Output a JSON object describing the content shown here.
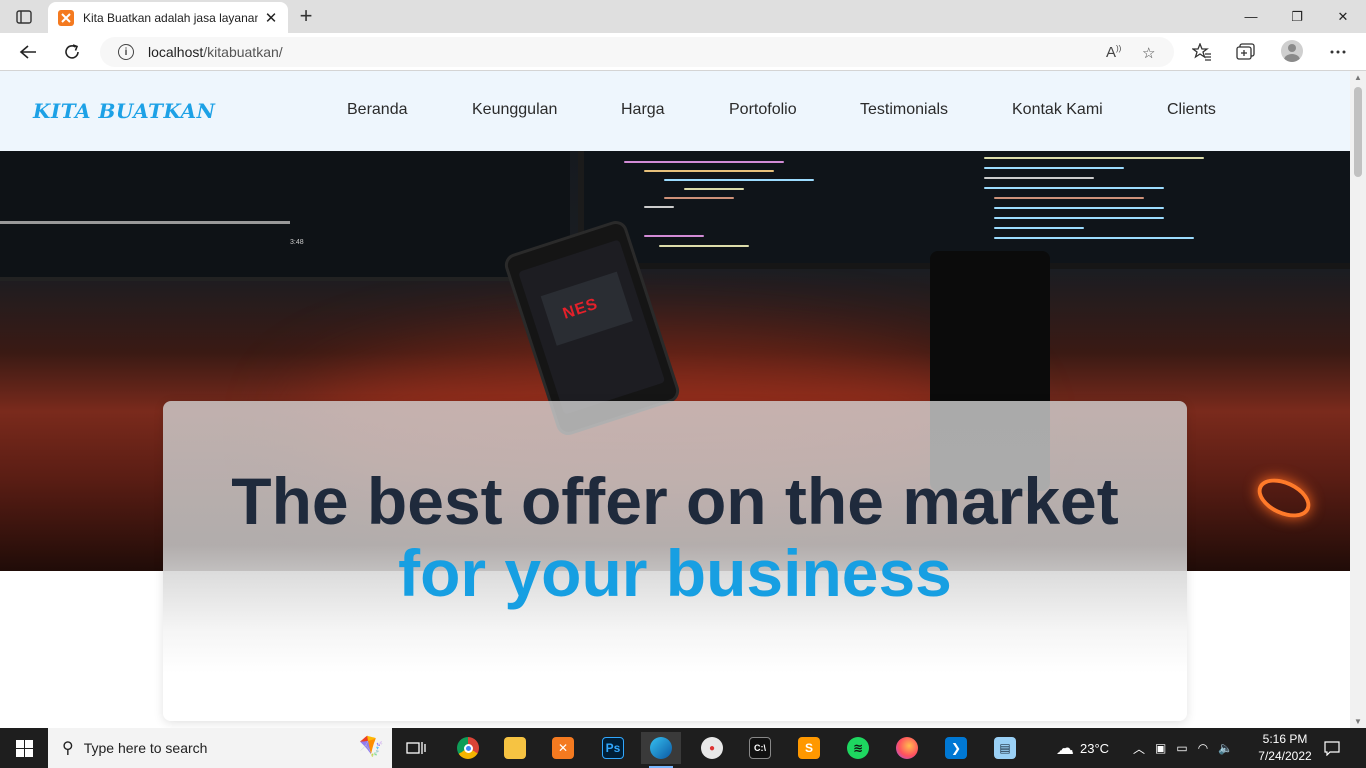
{
  "browser": {
    "tab": {
      "title": "Kita Buatkan adalah jasa layanan",
      "close": "✕"
    },
    "new_tab": "+",
    "window": {
      "minimize": "—",
      "maximize": "❐",
      "close": "✕"
    },
    "address": {
      "host": "localhost",
      "path": "/kitabuatkan/"
    },
    "icons": [
      "back-icon",
      "refresh-icon",
      "info-icon",
      "read-aloud-icon",
      "add-favorite-icon",
      "favorites-icon",
      "collections-icon",
      "profile-icon",
      "more-icon"
    ]
  },
  "site": {
    "logo": "KITA BUATKAN",
    "nav": [
      "Beranda",
      "Keunggulan",
      "Harga",
      "Portofolio",
      "Testimonials",
      "Kontak Kami",
      "Clients"
    ],
    "hero": {
      "line1": "The best offer on the market",
      "line2": "for your business"
    },
    "phone_art": "NES"
  },
  "taskbar": {
    "search_placeholder": "Type here to search",
    "apps": [
      "task-view",
      "chrome",
      "file-explorer",
      "xampp",
      "photoshop",
      "edge",
      "paint",
      "terminal",
      "sublime-text",
      "spotify",
      "firefox",
      "vscode",
      "notepad"
    ],
    "weather": "23°C",
    "time": "5:16 PM",
    "date": "7/24/2022"
  },
  "colors": {
    "brand": "#1da1e6",
    "hero_dark": "#1f2a3c",
    "hero_accent": "#179fe2",
    "nav_bg": "#eef6fd"
  }
}
